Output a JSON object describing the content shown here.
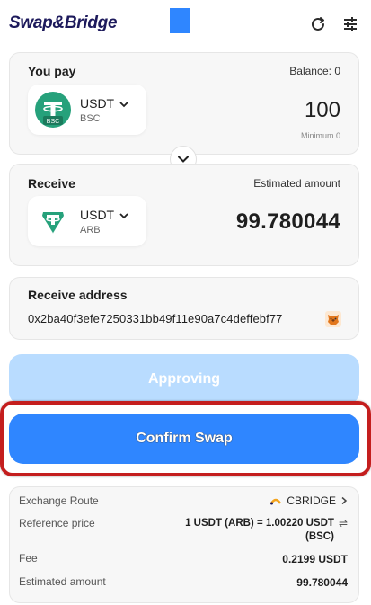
{
  "header": {
    "logo": "Swap&Bridge",
    "icons": {
      "refresh": "refresh-icon",
      "settings": "sliders-icon"
    }
  },
  "pay": {
    "label": "You pay",
    "balance": "Balance: 0",
    "token": "USDT",
    "chain": "BSC",
    "amount": "100",
    "minimum": "Minimum 0"
  },
  "receive": {
    "label": "Receive",
    "estimated_label": "Estimated amount",
    "token": "USDT",
    "chain": "ARB",
    "amount": "99.780044"
  },
  "address": {
    "label": "Receive address",
    "value": "0x2ba40f3efe7250331bb49f11e90a7c4deffebf77"
  },
  "buttons": {
    "approving": "Approving",
    "confirm": "Confirm Swap"
  },
  "info": {
    "route_label": "Exchange Route",
    "route_value": "CBRIDGE",
    "ref_label": "Reference price",
    "ref_value": "1 USDT (ARB) = 1.00220 USDT (BSC)",
    "fee_label": "Fee",
    "fee_value": "0.2199 USDT",
    "est_label": "Estimated amount",
    "est_value": "99.780044"
  },
  "colors": {
    "accent": "#2f86ff",
    "disabled": "#b9dcff",
    "highlight": "#c41e1e",
    "tether_bsc": "#26a17b",
    "tether_arb": "#26a17b"
  }
}
